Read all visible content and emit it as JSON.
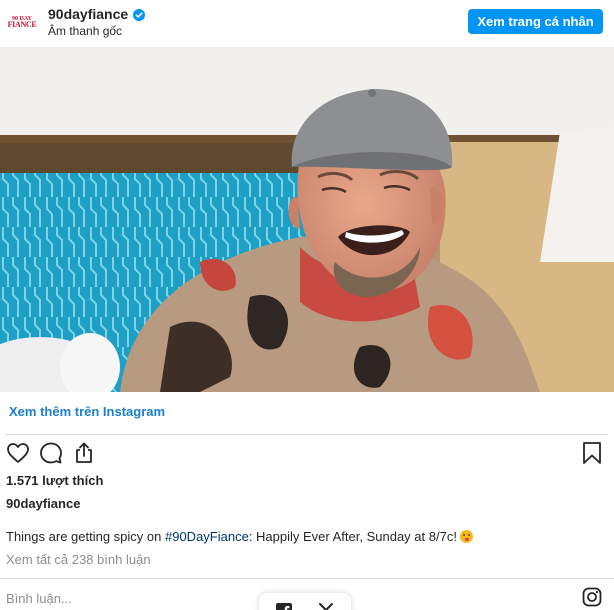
{
  "header": {
    "avatar_line1": "90 DAY",
    "avatar_line2": "FIANCE",
    "username": "90dayfiance",
    "subtitle": "Âm thanh gốc",
    "profile_button": "Xem trang cá nhân"
  },
  "colors": {
    "accent": "#0095f6",
    "link": "#1a7fd1",
    "hashtag": "#00376b",
    "muted": "#8e8e8e",
    "divider": "#dbdbdb"
  },
  "post": {
    "more_link": "Xem thêm trên Instagram",
    "likes": "1.571 lượt thích",
    "owner": "90dayfiance",
    "caption_before": "Things are getting spicy on ",
    "caption_hashtag": "#90DayFiance",
    "caption_after": ": Happily Ever After, Sunday at 8/7c!",
    "view_comments": "Xem tất cả 238 bình luận",
    "comment_placeholder": "Bình luận..."
  },
  "icons": {
    "like": "heart-icon",
    "comment": "comment-icon",
    "share": "share-icon",
    "save": "bookmark-icon",
    "brand": "instagram-icon",
    "verified": "verified-badge-icon",
    "facebook": "facebook-icon",
    "x": "x-icon"
  }
}
